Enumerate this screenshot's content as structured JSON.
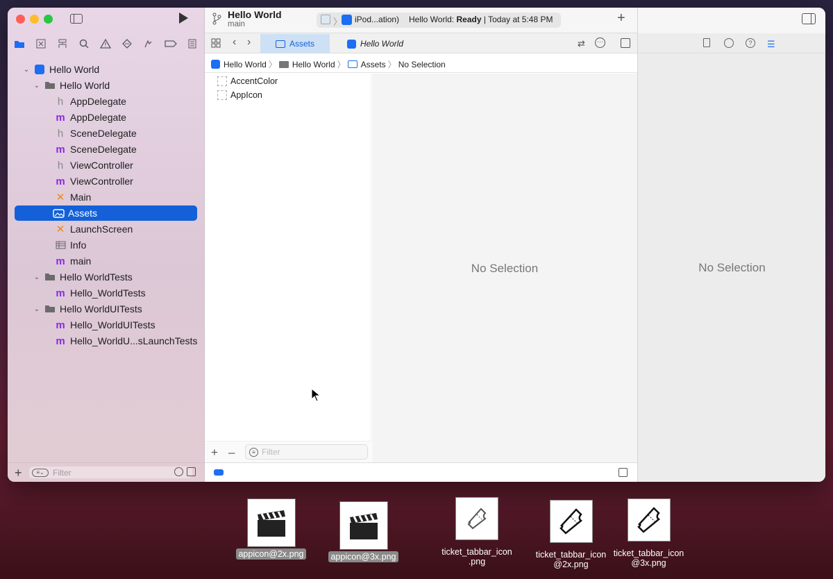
{
  "window": {
    "project_title": "Hello World",
    "branch": "main",
    "scheme_device": "iPod...ation)",
    "status_project": "Hello World:",
    "status_state": "Ready",
    "status_time": "| Today at 5:48 PM"
  },
  "navigator": {
    "items": [
      {
        "label": "Hello World",
        "icon": "project-icon"
      },
      {
        "label": "Hello World",
        "icon": "folder-icon"
      },
      {
        "label": "AppDelegate",
        "icon": "h"
      },
      {
        "label": "AppDelegate",
        "icon": "m"
      },
      {
        "label": "SceneDelegate",
        "icon": "h"
      },
      {
        "label": "SceneDelegate",
        "icon": "m"
      },
      {
        "label": "ViewController",
        "icon": "h"
      },
      {
        "label": "ViewController",
        "icon": "m"
      },
      {
        "label": "Main",
        "icon": "storyboard-icon"
      },
      {
        "label": "Assets",
        "icon": "assets-icon"
      },
      {
        "label": "LaunchScreen",
        "icon": "storyboard-icon"
      },
      {
        "label": "Info",
        "icon": "plist-icon"
      },
      {
        "label": "main",
        "icon": "m"
      },
      {
        "label": "Hello WorldTests",
        "icon": "folder-icon"
      },
      {
        "label": "Hello_WorldTests",
        "icon": "m"
      },
      {
        "label": "Hello WorldUITests",
        "icon": "folder-icon"
      },
      {
        "label": "Hello_WorldUITests",
        "icon": "m"
      },
      {
        "label": "Hello_WorldU...sLaunchTests",
        "icon": "m"
      }
    ],
    "filter_placeholder": "Filter"
  },
  "editor": {
    "tabs": [
      {
        "label": "Assets"
      },
      {
        "label": "Hello World"
      }
    ],
    "breadcrumb": [
      "Hello World",
      "Hello World",
      "Assets",
      "No Selection"
    ],
    "assets": [
      "AccentColor",
      "AppIcon"
    ],
    "filter_placeholder": "Filter",
    "empty_label": "No Selection"
  },
  "inspector": {
    "empty_label": "No Selection"
  },
  "desktop": {
    "files": [
      {
        "name": "appicon@2x.png"
      },
      {
        "name": "appicon@3x.png"
      },
      {
        "name": "ticket_tabbar_icon\n.png"
      },
      {
        "name": "ticket_tabbar_icon\n@2x.png"
      },
      {
        "name": "ticket_tabbar_icon\n@3x.png"
      }
    ]
  },
  "colors": {
    "accent": "#1360d8",
    "selection": "#1360d8"
  }
}
